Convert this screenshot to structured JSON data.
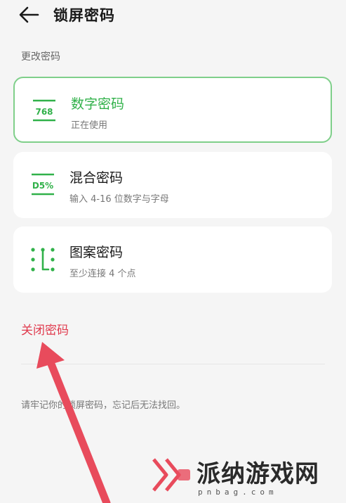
{
  "header": {
    "title": "锁屏密码",
    "back_icon": "arrow-left-icon"
  },
  "section": {
    "label": "更改密码"
  },
  "options": [
    {
      "icon_text": "768",
      "name": "数字密码",
      "sub": "正在使用",
      "selected": true
    },
    {
      "icon_text": "D5%",
      "name": "混合密码",
      "sub": "输入 4-16 位数字与字母",
      "selected": false
    },
    {
      "icon_text": "",
      "name": "图案密码",
      "sub": "至少连接 4 个点",
      "selected": false
    }
  ],
  "actions": {
    "close_password": "关闭密码"
  },
  "note": "请牢记你的锁屏密码，忘记后无法找回。",
  "watermark": {
    "text": "派纳游戏网",
    "sub": "pnbag.com"
  },
  "colors": {
    "accent": "#31b14a",
    "danger": "#e03a4d",
    "card_border": "#7fcf8a",
    "arrow": "#e84b5c"
  }
}
